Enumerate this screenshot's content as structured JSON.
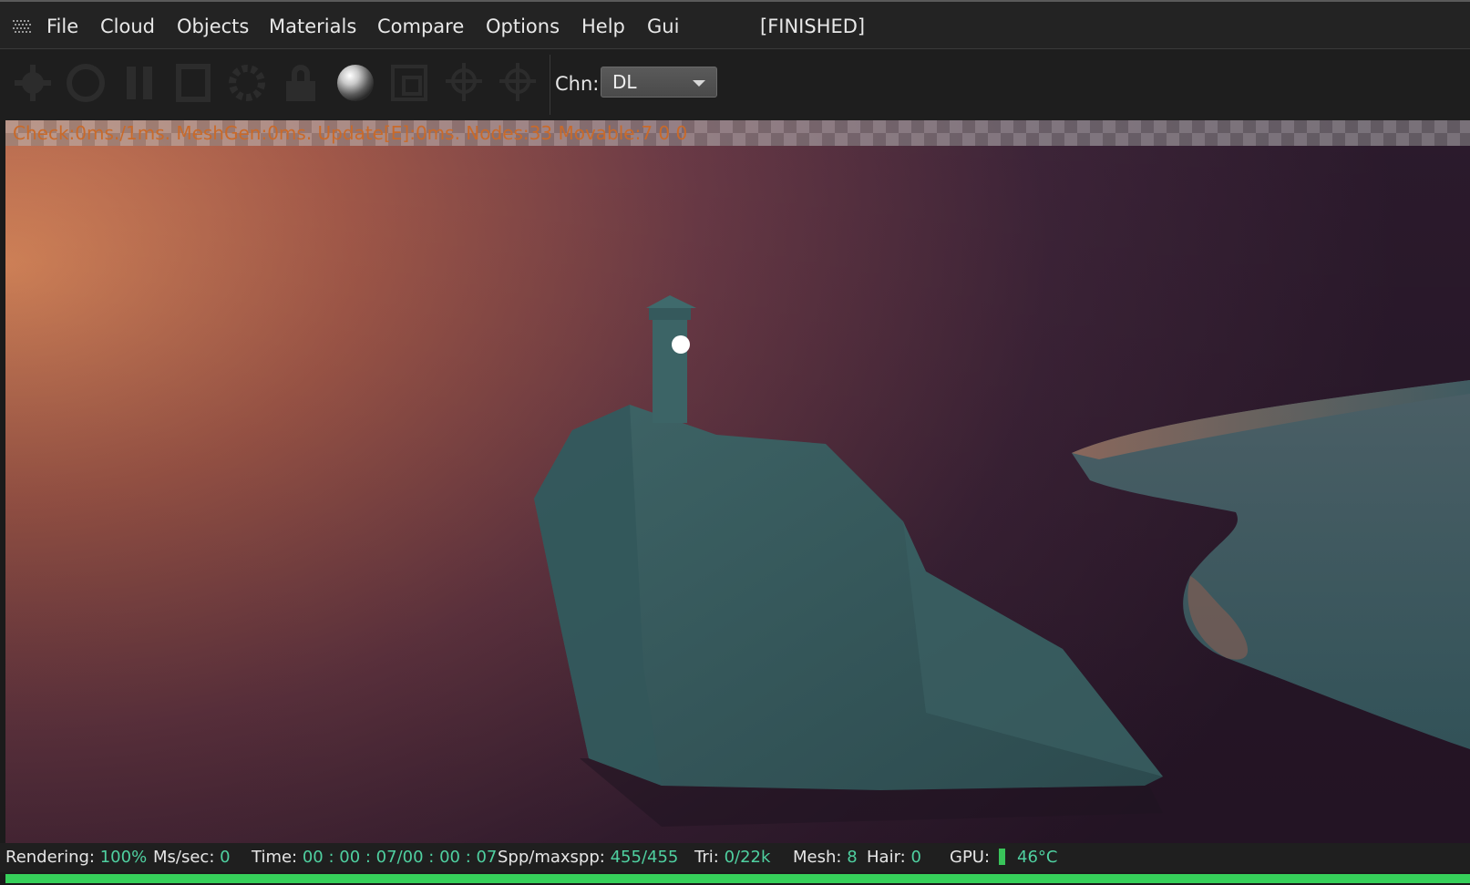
{
  "menubar": {
    "items": [
      "File",
      "Cloud",
      "Objects",
      "Materials",
      "Compare",
      "Options",
      "Help",
      "Gui"
    ],
    "status": "[FINISHED]"
  },
  "toolbar": {
    "buttons": [
      "settings-icon",
      "record-icon",
      "pause-icon",
      "stop-icon",
      "gear-icon",
      "lock-icon",
      "render-sphere-icon",
      "region-icon",
      "focus-picker-icon",
      "white-balance-picker-icon"
    ],
    "channel_label": "Chn:",
    "channel_value": "DL"
  },
  "viewport": {
    "stats": "Check:0ms./1ms. MeshGen:0ms. Update[E]:0ms. Nodes:33 Movable:7  0 0"
  },
  "statusbar": {
    "rendering_label": "Rendering:",
    "rendering_value": "100%",
    "mssec_label": "Ms/sec:",
    "mssec_value": "0",
    "time_label": "Time:",
    "time_value": "00 : 00 : 07/00 : 00 : 07",
    "spp_label": "Spp/maxspp:",
    "spp_value": "455/455",
    "tri_label": "Tri:",
    "tri_value": "0/22k",
    "mesh_label": "Mesh:",
    "mesh_value": "8",
    "hair_label": "Hair:",
    "hair_value": "0",
    "gpu_label": "GPU:",
    "gpu_temp": "46°C"
  },
  "progress": {
    "value": 1.0
  },
  "colors": {
    "accent": "#36d05a",
    "value_text": "#4fd0a0",
    "stats_text": "#c96a2a"
  }
}
